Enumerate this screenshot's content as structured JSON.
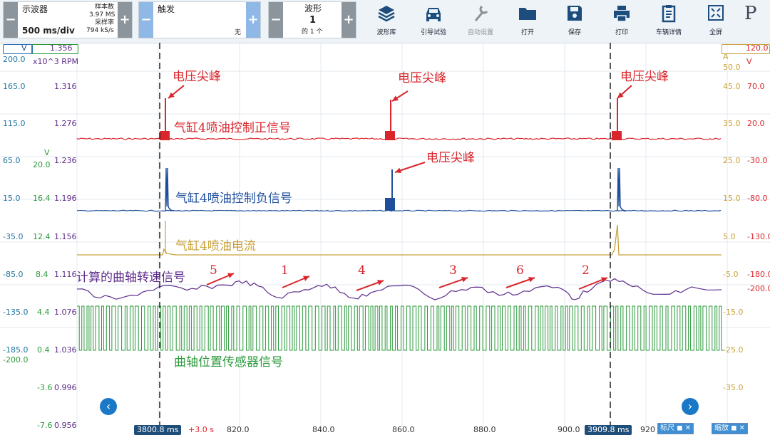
{
  "toolbar": {
    "scope": {
      "mode": "示波器",
      "timebase": "500 ms/div",
      "samples_label": "样本数",
      "samples_value": "3.97 MS",
      "rate_label": "采样率",
      "rate_value": "794 kS/s"
    },
    "trigger": {
      "label": "触发",
      "value": "无"
    },
    "waveform": {
      "label": "波形",
      "current": "1",
      "of": "的 1 个"
    },
    "buttons": [
      {
        "label": "波形库",
        "icon": "stack-icon",
        "enabled": true
      },
      {
        "label": "引导试验",
        "icon": "car-icon",
        "enabled": true
      },
      {
        "label": "自动设置",
        "icon": "wrench-icon",
        "enabled": false
      },
      {
        "label": "打开",
        "icon": "folder-icon",
        "enabled": true
      },
      {
        "label": "保存",
        "icon": "floppy-icon",
        "enabled": true
      },
      {
        "label": "打印",
        "icon": "printer-icon",
        "enabled": true
      },
      {
        "label": "车辆详情",
        "icon": "clipboard-icon",
        "enabled": true
      },
      {
        "label": "全屏",
        "icon": "fullscreen-icon",
        "enabled": true
      }
    ],
    "logo": "P"
  },
  "scales": {
    "left_a": {
      "values": [
        "200.0",
        "165.0",
        "115.0",
        "65.0",
        "15.0",
        "-35.0",
        "-85.0",
        "-135.0",
        "-185.0"
      ]
    },
    "left_v": {
      "unit": "V",
      "values": [
        "20.0",
        "16.4",
        "12.4",
        "8.4",
        "4.4",
        "0.4",
        "-200.0",
        "-3.6",
        "-7.6"
      ]
    },
    "rpm": {
      "unit": "x10^3 RPM",
      "top_value": "1.356",
      "values": [
        "1.316",
        "1.276",
        "1.236",
        "1.196",
        "1.156",
        "1.116",
        "1.076",
        "1.036",
        "0.996",
        "0.956"
      ]
    },
    "right_a": {
      "unit": "A",
      "values": [
        "50.0",
        "45.0",
        "35.0",
        "25.0",
        "15.0",
        "5.0",
        "-5.0",
        "-15.0",
        "-25.0",
        "-35.0"
      ]
    },
    "right_v": {
      "unit": "V",
      "top_value": "120.0",
      "values": [
        "70.0",
        "20.0",
        "-30.0",
        "-80.0",
        "-130.0",
        "-180.0",
        "-200.0"
      ]
    },
    "left_v_badge": "V"
  },
  "annotations": {
    "spike": "电压尖峰",
    "ch_pos": "气缸4喷油控制正信号",
    "ch_neg": "气缸4喷油控制负信号",
    "ch_current": "气缸4喷油电流",
    "ch_rpm": "计算的曲轴转速信号",
    "ch_crank": "曲轴位置传感器信号",
    "cyl_numbers": [
      "5",
      "1",
      "4",
      "3",
      "6",
      "2"
    ]
  },
  "time_axis": {
    "labels": [
      "820.0",
      "840.0",
      "860.0",
      "880.0",
      "900.0",
      "920"
    ],
    "ruler_left": "3800.8 ms",
    "delta": "+3.0 s",
    "ruler_right": "3909.8 ms",
    "rulers_btn": "标尺",
    "zoom_btn": "缩放"
  },
  "colors": {
    "pos": "#d9262c",
    "neg": "#1f4f9c",
    "current": "#c9a23a",
    "rpm": "#5c2b8a",
    "crank": "#2b9a3b",
    "accent": "#1b78c6"
  }
}
